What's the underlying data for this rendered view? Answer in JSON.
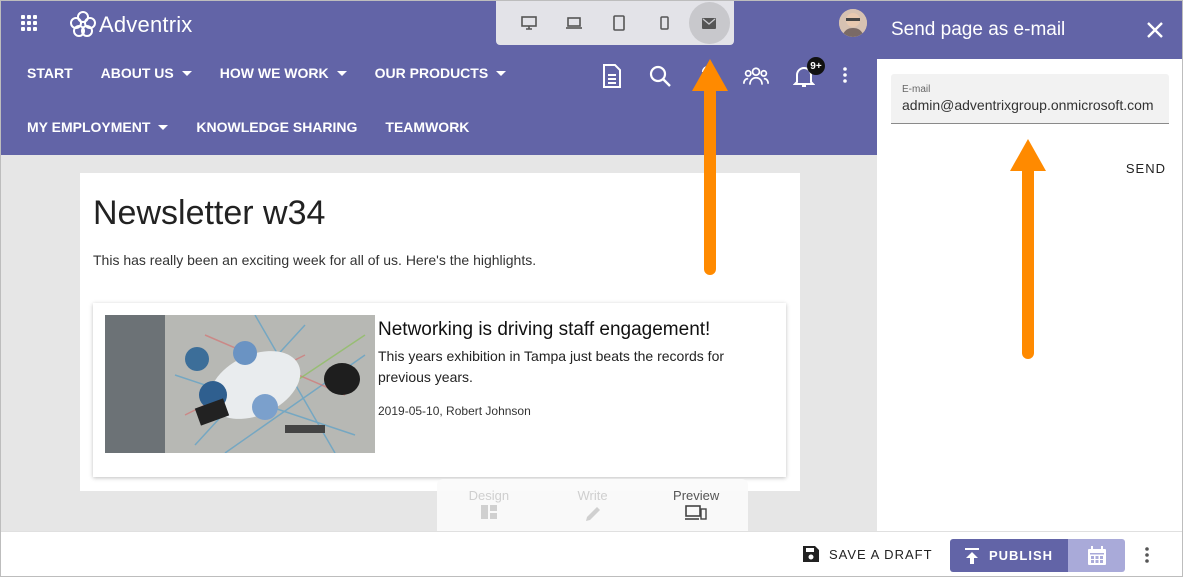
{
  "brand": {
    "name": "Adventrix"
  },
  "nav": {
    "row1": [
      {
        "label": "START",
        "dropdown": false
      },
      {
        "label": "ABOUT US",
        "dropdown": true
      },
      {
        "label": "HOW WE WORK",
        "dropdown": true
      },
      {
        "label": "OUR PRODUCTS",
        "dropdown": true
      }
    ],
    "row2": [
      {
        "label": "MY EMPLOYMENT",
        "dropdown": true
      },
      {
        "label": "KNOWLEDGE SHARING",
        "dropdown": false
      },
      {
        "label": "TEAMWORK",
        "dropdown": false
      }
    ]
  },
  "header_icons": {
    "notification_badge": "9+"
  },
  "page": {
    "title": "Newsletter w34",
    "intro": "This has really been an exciting week for all of us. Here's the highlights."
  },
  "news": {
    "title": "Networking is driving staff engagement!",
    "description": "This years exhibition in Tampa just beats the records for previous years.",
    "meta": "2019-05-10, Robert Johnson"
  },
  "modes": {
    "design": "Design",
    "write": "Write",
    "preview": "Preview"
  },
  "panel": {
    "title": "Send page as e-mail",
    "email_label": "E-mail",
    "email_value": "admin@adventrixgroup.onmicrosoft.com",
    "send_label": "SEND"
  },
  "bottom": {
    "save_draft": "SAVE A DRAFT",
    "publish": "PUBLISH"
  },
  "colors": {
    "brand": "#6264a7",
    "arrow": "#ff8a00",
    "schedule": "#a9aad9"
  }
}
